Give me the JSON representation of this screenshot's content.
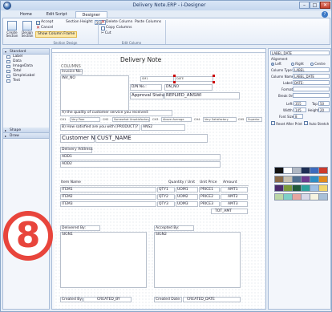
{
  "window": {
    "title": "Delivery Note.ERP - i-Designer",
    "min": "–",
    "max": "□",
    "close": "✕"
  },
  "ribbon": {
    "tabs": [
      "Home",
      "Edit Script",
      "Designer"
    ],
    "create_section": "Create Section",
    "design_section": "Design Section",
    "accept": "Accept",
    "cancel": "Cancel",
    "show_column_frame": "Show Column Frame",
    "section_height_label": "Section Height:",
    "section_height_value": "350",
    "delete_column": "Delete Column",
    "paste_columns": "Paste Columns",
    "copy_columns": "Copy Columns",
    "cut": "Cut",
    "group_section_design": "Section Design",
    "group_edit_column": "Edit Column"
  },
  "left_panel": {
    "standard_header": "Standard",
    "items": [
      "Label",
      "Data",
      "ImageData",
      "Total",
      "SimpleLabel",
      "Text"
    ],
    "shape_header": "Shape",
    "draw_header": "Draw"
  },
  "page": {
    "title": "Delivery Note",
    "columns_label": "COLUMNS",
    "invoice_no_label": "Invoice No.:",
    "inv_no": "INV_NO",
    "sm1": "SM1",
    "date_small": "DATE",
    "dn_no_label": "D/N No.:",
    "dn_no": "DN_NO",
    "approval_label": "Approval Status:",
    "approval_value": "REPLIED_ANSWI",
    "q_a": "A) the quality of customer service you received:",
    "ratings": [
      "Very Poor",
      "Somewhat Unsatisfactory",
      "Above Average",
      "Very Satisfactory",
      "Superior"
    ],
    "rating_codes": [
      "CH1",
      "CH2",
      "CH3",
      "CH4",
      "CH5"
    ],
    "q_b": "B) How satisfied are you with [PRODUCT]?",
    "ans2": "ANS2",
    "customer_name_label": "Customer Name:",
    "cust_name": "CUST_NAME",
    "delivery_address_label": "Delivery Address:",
    "add1": "ADD1",
    "add2": "ADD2",
    "item_name_header": "Item Name",
    "qty_unit_header": "Quantity / Unit",
    "unit_price_header": "Unit Price",
    "amount_header": "Amount",
    "rows": [
      {
        "item": "ITEM1",
        "qty": "QTY1",
        "uom": "UOM1",
        "price": "PRICE1",
        "amt": "AMT1"
      },
      {
        "item": "ITEM2",
        "qty": "QTY2",
        "uom": "UOM2",
        "price": "PRICE2",
        "amt": "AMT2"
      },
      {
        "item": "ITEM3",
        "qty": "QTY3",
        "uom": "UOM3",
        "price": "PRICE3",
        "amt": "AMT3"
      }
    ],
    "tot_amt": "TOT_AMT",
    "delivered_by_label": "Delivered By:",
    "sign1": "SIGN1",
    "accepted_by_label": "Accepted By:",
    "sign2": "SIGN2",
    "created_by_label": "Created By:",
    "created_by": "CREATED_BY",
    "created_date_label": "Created Date:",
    "created_date": "CREATED_DATE"
  },
  "right_panel": {
    "selector": "LABEL_DATE",
    "alignment_label": "Alignment",
    "align_left": "Left",
    "align_right": "Right",
    "align_centre": "Centre",
    "column_type_label": "Column Type:",
    "column_type": "LABEL",
    "column_name_label": "Column Name:",
    "column_name": "LABEL_DATE",
    "label_label": "Label:",
    "label_value": "DATE:",
    "format_label": "Format:",
    "format_value": "",
    "break_on_label": "Break On:",
    "break_on_value": "",
    "left_label": "Left:",
    "left_value": "355",
    "top_label": "Top:",
    "top_value": "50",
    "width_label": "Width:",
    "width_value": "145",
    "height_label": "Height:",
    "height_value": "20",
    "font_size_label": "Font Size:",
    "font_size_value": "8",
    "reset_after_print": "Reset After Print",
    "auto_stretch": "Auto Stretch",
    "palette_colors": [
      "#111111",
      "#ffffff",
      "#b0b8c4",
      "#1e2f55",
      "#3d6bbd",
      "#cc3b2c",
      "#8a6a48",
      "#c8c1b0",
      "#4f6f8f",
      "#6b3b8f",
      "#2e8ec4",
      "#e08a1e",
      "#4b2a6b",
      "#7a9a3a",
      "#1f5a3a",
      "#2ca39c",
      "#9fc0e4",
      "#f2d66b",
      "#bcd7a7",
      "#7fd0c8",
      "#e6a6a0",
      "#d8d8e8",
      "#f7f3e0",
      "#a8c0d8"
    ]
  },
  "badge": {
    "text": "8"
  }
}
